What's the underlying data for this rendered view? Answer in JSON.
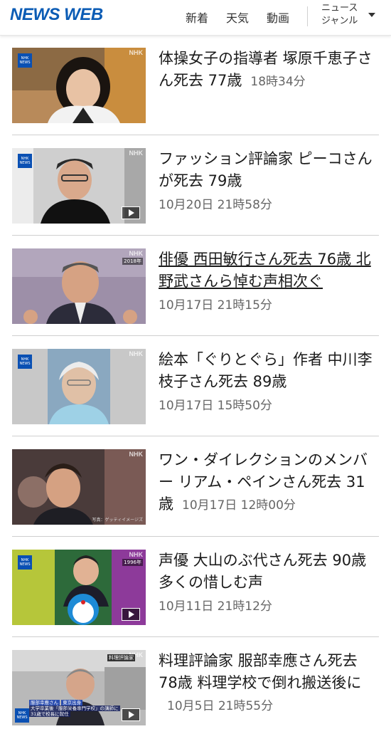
{
  "header": {
    "logo": "NEWS WEB",
    "nav": [
      "新着",
      "天気",
      "動画"
    ],
    "genre_line1": "ニュース",
    "genre_line2": "ジャンル"
  },
  "badges": {
    "nhk": "NHK",
    "news": "NEWS",
    "watermark": "NHK",
    "year_2018": "2018年",
    "year_1996": "1996年"
  },
  "thumb_texts": {
    "credit_5": "写真：ゲッティイメージズ",
    "label_7a": "服部幸應さん",
    "label_7b": "東京出身",
    "label_7c": "大学卒業後「服部栄養専門学校」の講師に",
    "label_7d": "31歳で校長に就任",
    "board_7": "料理評論家"
  },
  "articles": [
    {
      "title": "体操女子の指導者 塚原千恵子さん死去 77歳",
      "time": "18時34分",
      "video": false
    },
    {
      "title": "ファッション評論家 ピーコさんが死去 79歳",
      "time": "10月20日 21時58分",
      "video": true
    },
    {
      "title": "俳優 西田敏行さん死去 76歳 北野武さんら悼む声相次ぐ",
      "time": "10月17日 21時15分",
      "video": false
    },
    {
      "title": "絵本「ぐりとぐら」作者 中川李枝子さん死去 89歳",
      "time": "10月17日 15時50分",
      "video": false
    },
    {
      "title": "ワン・ダイレクションのメンバー リアム・ペインさん死去 31歳",
      "time": "10月17日 12時00分",
      "video": false
    },
    {
      "title": "声優 大山のぶ代さん死去 90歳 多くの惜しむ声",
      "time": "10月11日 21時12分",
      "video": true
    },
    {
      "title": "料理評論家 服部幸應さん死去 78歳 料理学校で倒れ搬送後に",
      "time": "10月5日 21時55分",
      "video": true
    }
  ]
}
